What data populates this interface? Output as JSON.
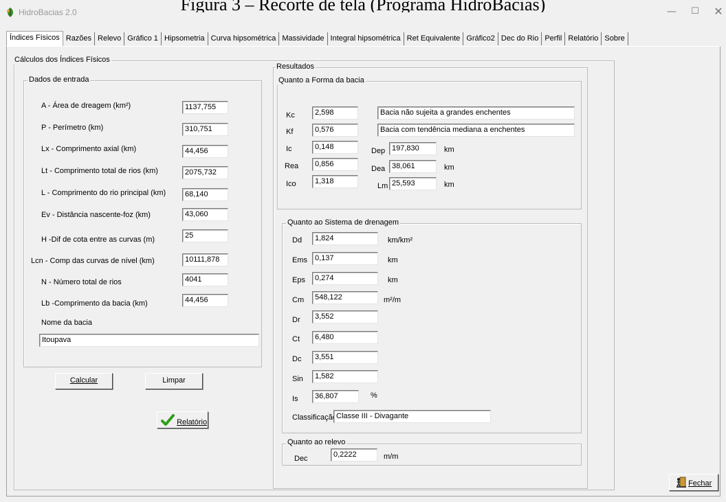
{
  "caption": "Figura 3 – Recorte de tela (Programa HidroBacias)",
  "window": {
    "title": "HidroBacias 2.0"
  },
  "tabs": [
    "Índices Físicos",
    "Razões",
    "Relevo",
    "Gráfico 1",
    "Hipsometria",
    "Curva hipsométrica",
    "Massividade",
    "Integral hipsométrica",
    "Ret Equivalente",
    "Gráfico2",
    "Dec do Rio",
    "Perfil",
    "Relatório",
    "Sobre"
  ],
  "calc_group": "Cálculos dos Índices Físicos",
  "input_group": "Dados de entrada",
  "inputs": [
    {
      "label": "A - Área de dreagem (km²)",
      "value": "1137,755"
    },
    {
      "label": "P - Perímetro  (km)",
      "value": "310,751"
    },
    {
      "label": "Lx -  Comprimento axial (km)",
      "value": "44,456"
    },
    {
      "label": "Lt - Comprimento total de rios (km)",
      "value": "2075,732"
    },
    {
      "label": "L - Comprimento do rio principal (km)",
      "value": "68,140"
    },
    {
      "label": "Ev - Distância nascente-foz (km)",
      "value": "43,060"
    },
    {
      "label": "H -Dif de cota entre as curvas (m)",
      "value": "25"
    },
    {
      "label": "Lcn - Comp das curvas de nível (km)",
      "value": "10111,878"
    },
    {
      "label": "N - Número total de rios",
      "value": "4041"
    },
    {
      "label": "Lb -Comprimento da bacia (km)",
      "value": "44,456"
    }
  ],
  "basin": {
    "label": "Nome da bacia",
    "value": "Itoupava"
  },
  "buttons": {
    "calcular": "Calcular",
    "limpar": "Limpar",
    "relatorio": "Relatório",
    "fechar": "Fechar"
  },
  "results_group": "Resultados",
  "forma": {
    "group": "Quanto a Forma da bacia",
    "kc": {
      "label": "Kc",
      "value": "2,598",
      "desc": "Bacia não sujeita a grandes enchentes"
    },
    "kf": {
      "label": "Kf",
      "value": "0,576",
      "desc": "Bacia com tendência mediana a enchentes"
    },
    "ic": {
      "label": "Ic",
      "value": "0,148"
    },
    "rea": {
      "label": "Rea",
      "value": "0,856"
    },
    "ico": {
      "label": "Ico",
      "value": "1,318"
    },
    "dep": {
      "label": "Dep",
      "value": "197,830",
      "unit": "km"
    },
    "dea": {
      "label": "Dea",
      "value": "38,061",
      "unit": "km"
    },
    "lm": {
      "label": "Lm",
      "value": "25,593",
      "unit": "km"
    }
  },
  "drenagem": {
    "group": "Quanto ao Sistema de drenagem",
    "rows": [
      {
        "label": "Dd",
        "value": "1,824",
        "unit": "km/km²"
      },
      {
        "label": "Ems",
        "value": "0,137",
        "unit": "km"
      },
      {
        "label": "Eps",
        "value": "0,274",
        "unit": "km"
      },
      {
        "label": "Cm",
        "value": "548,122",
        "unit": "m²/m"
      },
      {
        "label": "Dr",
        "value": "3,552",
        "unit": ""
      },
      {
        "label": "Ct",
        "value": "6,480",
        "unit": ""
      },
      {
        "label": "Dc",
        "value": "3,551",
        "unit": ""
      },
      {
        "label": "Sin",
        "value": "1,582",
        "unit": ""
      },
      {
        "label": "Is",
        "value": "36,807",
        "unit": "%"
      }
    ],
    "classificacao": {
      "label": "Classificação",
      "value": "Classe III - Divagante"
    }
  },
  "relevo": {
    "group": "Quanto ao relevo",
    "label": "Dec",
    "value": "0,2222",
    "unit": "m/m"
  },
  "colors": {
    "check": "#2e9e1a",
    "accent": "#0078d7"
  }
}
